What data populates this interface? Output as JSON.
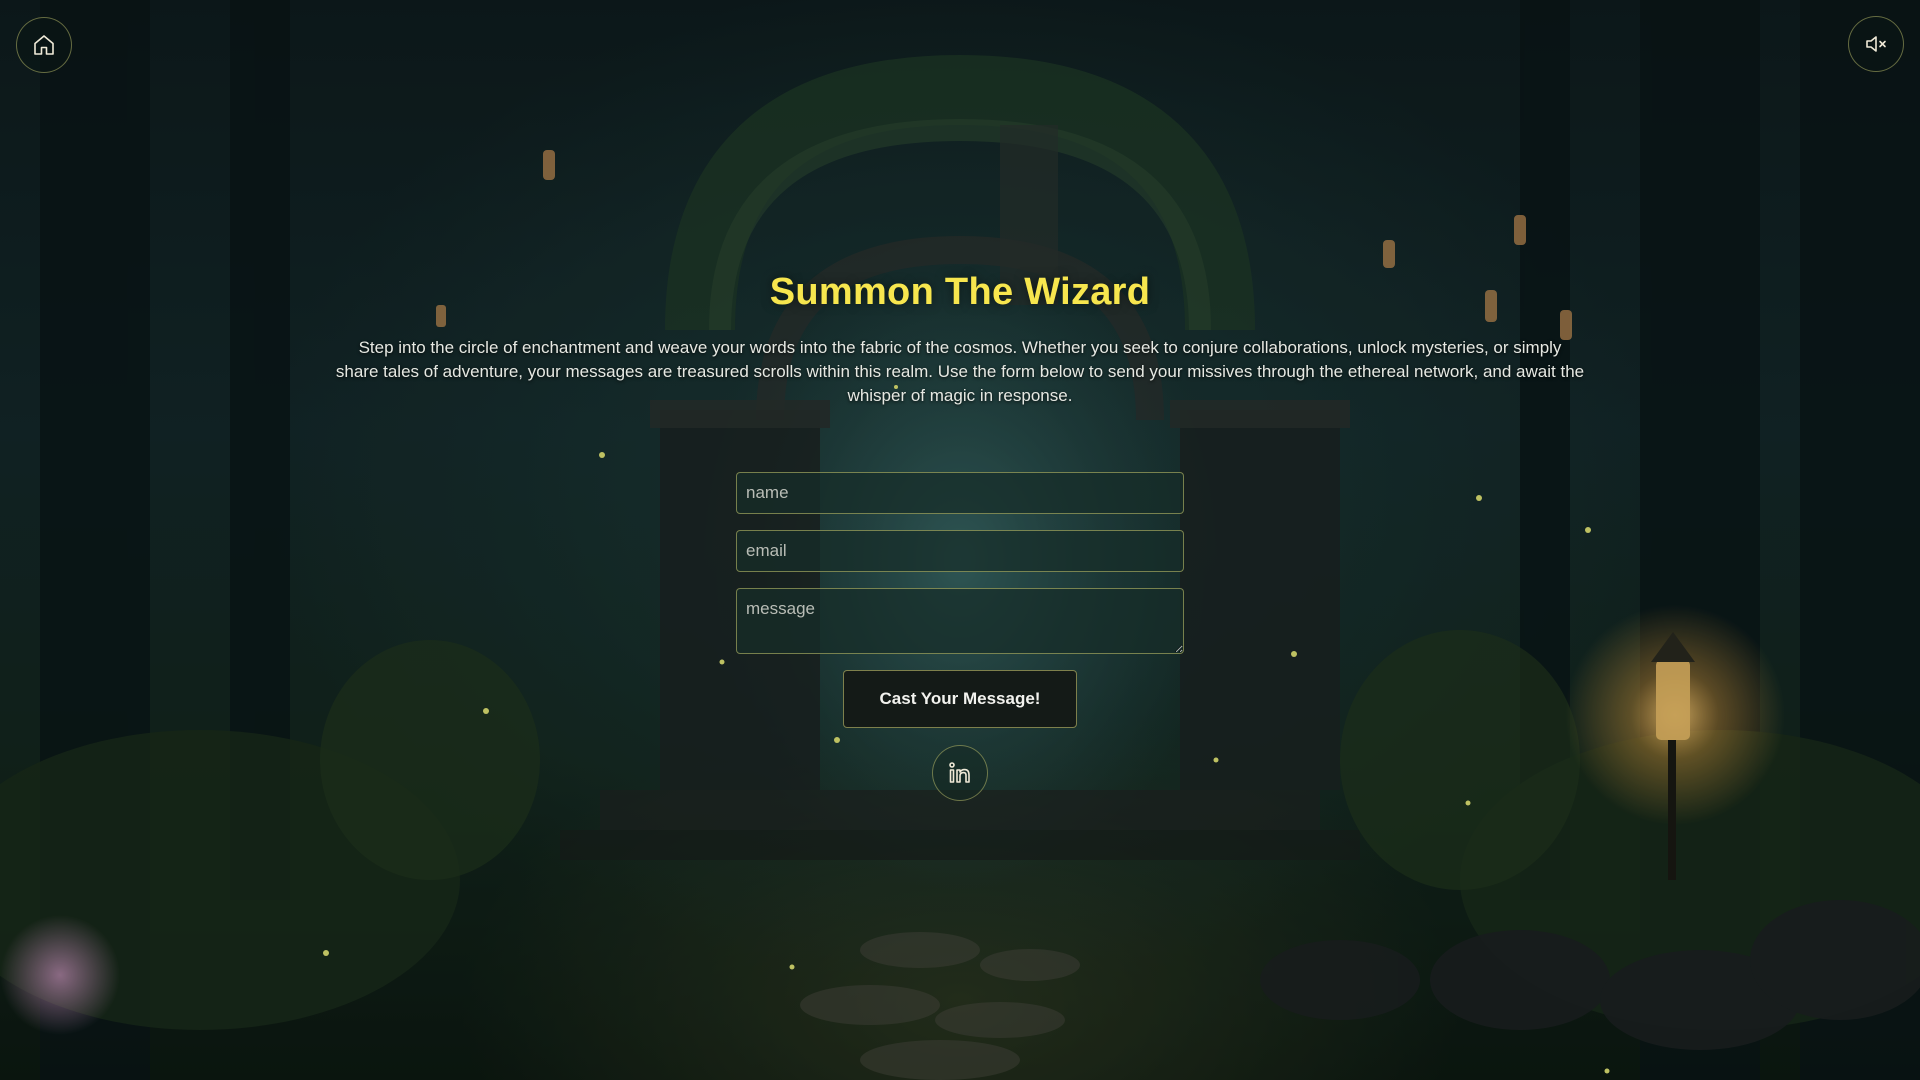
{
  "nav": {
    "home_icon": "home-icon",
    "sound_icon": "volume-mute-icon"
  },
  "heading": {
    "title": "Summon The Wizard",
    "intro": "Step into the circle of enchantment and weave your words into the fabric of the cosmos. Whether you seek to conjure collaborations, unlock mysteries, or simply share tales of adventure, your messages are treasured scrolls within this realm. Use the form below to send your missives through the ethereal network, and await the whisper of magic in response."
  },
  "form": {
    "name_placeholder": "name",
    "name_value": "",
    "email_placeholder": "email",
    "email_value": "",
    "message_placeholder": "message",
    "message_value": "",
    "submit_label": "Cast Your Message!"
  },
  "social": {
    "linkedin_icon": "linkedin-icon"
  },
  "colors": {
    "title": "#f7e64e",
    "accent_border": "#d6d678",
    "button_bg": "#141a17"
  }
}
